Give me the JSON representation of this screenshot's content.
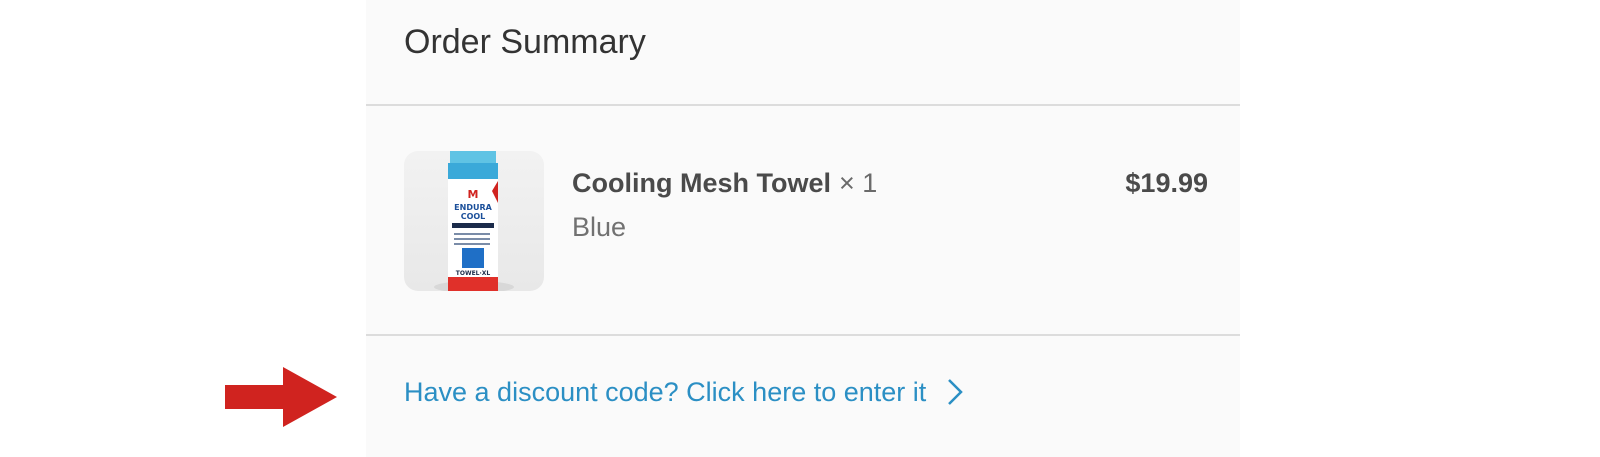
{
  "order_summary": {
    "title": "Order Summary",
    "items": [
      {
        "name": "Cooling Mesh Towel",
        "quantity": "× 1",
        "variant": "Blue",
        "price": "$19.99",
        "thumbnail_icon": "cooling-towel-product-image"
      }
    ],
    "discount": {
      "label": "Have a discount code? Click here to enter it",
      "icon": "chevron-right-icon"
    }
  },
  "annotation": {
    "icon": "red-arrow-pointer",
    "color": "#d0231f"
  },
  "colors": {
    "link": "#2b8fc4",
    "panel_background": "#fafafa",
    "divider": "#dcdcdc"
  }
}
